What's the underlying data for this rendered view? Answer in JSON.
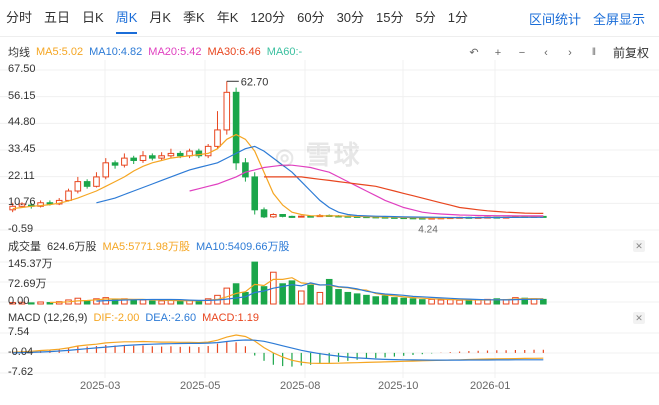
{
  "tabs": [
    "分时",
    "五日",
    "日K",
    "周K",
    "月K",
    "季K",
    "年K",
    "120分",
    "60分",
    "30分",
    "15分",
    "5分",
    "1分"
  ],
  "active_tab": "周K",
  "top_links": {
    "stats": "区间统计",
    "fullscreen": "全屏显示"
  },
  "price_legend": {
    "label": "均线",
    "items": [
      {
        "text": "MA5:5.02",
        "color": "#f5a623"
      },
      {
        "text": "MA10:4.82",
        "color": "#2d7bd6"
      },
      {
        "text": "MA20:5.42",
        "color": "#e040c0"
      },
      {
        "text": "MA30:6.46",
        "color": "#e8461f"
      },
      {
        "text": "MA60:-",
        "color": "#3cc0a0"
      }
    ]
  },
  "controls": {
    "adjust": "前复权"
  },
  "price_axis": [
    "67.50",
    "56.15",
    "44.80",
    "33.45",
    "22.11",
    "10.76",
    "-0.59"
  ],
  "annotations": {
    "high": "62.70",
    "low": "4.24"
  },
  "watermark": "雪球",
  "volume_legend": {
    "label": "成交量",
    "value": "624.6万股",
    "items": [
      {
        "text": "MA5:5771.98万股",
        "color": "#f5a623"
      },
      {
        "text": "MA10:5409.66万股",
        "color": "#2d7bd6"
      }
    ]
  },
  "volume_axis": [
    "145.37万",
    "72.69万",
    "0.00"
  ],
  "macd_legend": {
    "label": "MACD (12,26,9)",
    "items": [
      {
        "text": "DIF:-2.00",
        "color": "#f5a623"
      },
      {
        "text": "DEA:-2.60",
        "color": "#2d7bd6"
      },
      {
        "text": "MACD:1.19",
        "color": "#e8461f"
      }
    ]
  },
  "macd_axis": [
    "7.54",
    "-0.04",
    "-7.62"
  ],
  "x_axis": [
    "2025-03",
    "2025-05",
    "2025-08",
    "2025-10",
    "2026-01"
  ],
  "chart_data": {
    "type": "candlestick",
    "price_ylim": [
      -0.59,
      67.5
    ],
    "volume_ylim": [
      0,
      145.37
    ],
    "macd_ylim": [
      -7.62,
      7.54
    ],
    "candles": [
      [
        8,
        9.5,
        7,
        11
      ],
      [
        9.5,
        10.5,
        9,
        11.2
      ],
      [
        10,
        9.5,
        8.5,
        11
      ],
      [
        9.5,
        11,
        9,
        12
      ],
      [
        11,
        10.5,
        9.8,
        12
      ],
      [
        10.5,
        12,
        10,
        13
      ],
      [
        12,
        16,
        11.5,
        17
      ],
      [
        16,
        20,
        15,
        22
      ],
      [
        20,
        18,
        17,
        21
      ],
      [
        18,
        22,
        17.5,
        24
      ],
      [
        22,
        28,
        21,
        30
      ],
      [
        28,
        27,
        25.5,
        29
      ],
      [
        27,
        30,
        26,
        32
      ],
      [
        30,
        29,
        27.5,
        31
      ],
      [
        29,
        31,
        28,
        33
      ],
      [
        31,
        30,
        29,
        32
      ],
      [
        30,
        31,
        29,
        32.5
      ],
      [
        31,
        32,
        30,
        34
      ],
      [
        32,
        31,
        30,
        33
      ],
      [
        31,
        33,
        30,
        34
      ],
      [
        33,
        31,
        30,
        34
      ],
      [
        31,
        35,
        30,
        36
      ],
      [
        35,
        42,
        34,
        50
      ],
      [
        42,
        58,
        40,
        62.7
      ],
      [
        58,
        28,
        25,
        60
      ],
      [
        28,
        22,
        20,
        30
      ],
      [
        22,
        8,
        6,
        24
      ],
      [
        8,
        5,
        4.5,
        9
      ],
      [
        5,
        6,
        4.6,
        6.5
      ],
      [
        6,
        5.2,
        4.8,
        6.2
      ],
      [
        5.2,
        5,
        4.6,
        5.5
      ],
      [
        5,
        5.3,
        4.8,
        5.6
      ],
      [
        5.3,
        5.1,
        4.9,
        5.5
      ],
      [
        5.1,
        5.6,
        5,
        6.2
      ],
      [
        5.6,
        5.4,
        5.1,
        6
      ],
      [
        5.4,
        5.3,
        5,
        5.8
      ],
      [
        5.3,
        5.2,
        5,
        5.6
      ],
      [
        5.2,
        5.1,
        4.9,
        5.4
      ],
      [
        5.1,
        5,
        4.8,
        5.3
      ],
      [
        5,
        4.9,
        4.7,
        5.2
      ],
      [
        4.9,
        4.8,
        4.6,
        5.1
      ],
      [
        4.8,
        4.7,
        4.5,
        5
      ],
      [
        4.7,
        4.6,
        4.4,
        4.9
      ],
      [
        4.6,
        4.5,
        4.3,
        4.8
      ],
      [
        4.5,
        4.4,
        4.24,
        4.7
      ],
      [
        4.4,
        4.5,
        4.3,
        4.7
      ],
      [
        4.5,
        4.6,
        4.4,
        4.8
      ],
      [
        4.6,
        4.7,
        4.5,
        4.9
      ],
      [
        4.7,
        4.8,
        4.6,
        5
      ],
      [
        4.8,
        4.7,
        4.6,
        5
      ],
      [
        4.7,
        4.8,
        4.6,
        5
      ],
      [
        4.8,
        4.9,
        4.7,
        5.1
      ],
      [
        4.9,
        4.8,
        4.7,
        5.1
      ],
      [
        4.8,
        4.9,
        4.7,
        5.1
      ],
      [
        4.9,
        5.2,
        4.8,
        5.6
      ],
      [
        5.2,
        5,
        4.8,
        5.4
      ],
      [
        5,
        5.2,
        4.9,
        5.6
      ],
      [
        5.2,
        5.1,
        4.9,
        5.4
      ]
    ],
    "volume": [
      5,
      6,
      4,
      7,
      5,
      8,
      14,
      20,
      12,
      18,
      22,
      15,
      18,
      12,
      14,
      10,
      11,
      13,
      10,
      12,
      10,
      18,
      30,
      55,
      70,
      40,
      145,
      60,
      110,
      70,
      80,
      45,
      65,
      40,
      85,
      50,
      40,
      35,
      30,
      25,
      28,
      22,
      20,
      18,
      15,
      16,
      14,
      15,
      13,
      12,
      14,
      16,
      18,
      15,
      22,
      20,
      18,
      16
    ],
    "macd": [
      0.5,
      0.8,
      0.9,
      1.1,
      1.2,
      1.5,
      2,
      2.5,
      2.4,
      2.6,
      3,
      2.8,
      3,
      2.7,
      2.8,
      2.5,
      2.4,
      2.5,
      2.3,
      2.4,
      2.2,
      2.6,
      3.5,
      4.5,
      4,
      2.5,
      -1,
      -3,
      -4.5,
      -5,
      -5.2,
      -4.8,
      -4.5,
      -4,
      -3.8,
      -3.4,
      -3,
      -2.6,
      -2.3,
      -2,
      -1.7,
      -1.4,
      -1.1,
      -0.8,
      -0.5,
      -0.2,
      0.1,
      0.3,
      0.5,
      0.7,
      0.8,
      0.9,
      1,
      1,
      1.1,
      1.1,
      1.2,
      1.19
    ],
    "price_ma": {
      "MA5": [
        8.5,
        9,
        9.5,
        9.8,
        10.2,
        10.8,
        11.8,
        13,
        14.5,
        16,
        18,
        20,
        22,
        24.5,
        26.5,
        28,
        29,
        30,
        30.5,
        31,
        31.5,
        32,
        34,
        38,
        40,
        38,
        33,
        24,
        15,
        10,
        7,
        6,
        5.5,
        5.4,
        5.4,
        5.4,
        5.3,
        5.2,
        5.1,
        5,
        4.95,
        4.85,
        4.75,
        4.65,
        4.55,
        4.5,
        4.5,
        4.55,
        4.6,
        4.65,
        4.7,
        4.75,
        4.8,
        4.85,
        4.9,
        4.95,
        5,
        5.02
      ],
      "MA10": [
        null,
        null,
        null,
        null,
        null,
        null,
        null,
        null,
        null,
        11,
        12,
        13,
        14.5,
        16,
        17.5,
        19,
        20.5,
        22,
        23.5,
        25,
        26,
        27,
        28,
        30,
        32,
        34,
        35,
        33,
        30,
        27,
        24,
        20,
        16,
        12,
        9,
        7,
        6,
        5.6,
        5.4,
        5.3,
        5.2,
        5.1,
        5,
        4.95,
        4.9,
        4.85,
        4.8,
        4.75,
        4.7,
        4.7,
        4.7,
        4.72,
        4.74,
        4.76,
        4.78,
        4.8,
        4.81,
        4.82
      ],
      "MA20": [
        null,
        null,
        null,
        null,
        null,
        null,
        null,
        null,
        null,
        null,
        null,
        null,
        null,
        null,
        null,
        null,
        null,
        null,
        null,
        16,
        17,
        18,
        19,
        20.5,
        22,
        24,
        25,
        26,
        26.5,
        27,
        27,
        26.5,
        26,
        25,
        24,
        22,
        20,
        18,
        16,
        14,
        12,
        10.5,
        9,
        8,
        7,
        6.5,
        6.2,
        6,
        5.8,
        5.7,
        5.6,
        5.55,
        5.5,
        5.48,
        5.46,
        5.44,
        5.43,
        5.42
      ],
      "MA30": [
        null,
        null,
        null,
        null,
        null,
        null,
        null,
        null,
        null,
        null,
        null,
        null,
        null,
        null,
        null,
        null,
        null,
        null,
        null,
        null,
        null,
        null,
        null,
        null,
        null,
        null,
        null,
        22,
        22,
        22,
        22,
        22,
        21.5,
        21,
        20.5,
        20,
        19.5,
        19,
        18.5,
        18,
        17,
        16,
        15,
        14,
        13,
        12,
        11,
        10,
        9,
        8.5,
        8,
        7.6,
        7.3,
        7,
        6.8,
        6.6,
        6.5,
        6.46
      ]
    },
    "volume_ma": {
      "MA5": [
        null,
        null,
        null,
        null,
        5.4,
        6,
        7.6,
        10.8,
        12.2,
        14.4,
        17.2,
        17.4,
        17,
        15.8,
        16.2,
        13.8,
        13,
        12,
        11.6,
        11.2,
        11.2,
        12.6,
        16,
        25,
        36.6,
        42.6,
        68,
        64,
        85,
        85,
        91,
        73,
        70,
        66,
        65,
        58,
        56,
        50,
        48,
        36,
        31,
        28,
        25,
        22,
        20,
        18,
        16.6,
        15.6,
        14.6,
        14,
        14,
        14,
        14.6,
        15.2,
        17,
        18.2,
        18.2,
        18.2
      ],
      "MA10": [
        null,
        null,
        null,
        null,
        null,
        null,
        null,
        null,
        null,
        9.9,
        11.6,
        12.5,
        13.9,
        14.4,
        15.3,
        15.5,
        15.6,
        15.5,
        15.3,
        13.6,
        12.5,
        12.5,
        13.7,
        17.1,
        20.7,
        24.8,
        39.9,
        44.9,
        54.7,
        60.5,
        66.7,
        62.7,
        72.9,
        65.9,
        66.9,
        59.8,
        57.3,
        52.3,
        44.3,
        38.8,
        34.6,
        32.5,
        30,
        26.4,
        24.8,
        22.9,
        21.1,
        19.9,
        18.1,
        16.8,
        15.5,
        14.6,
        14.6,
        14.3,
        15.3,
        15.9,
        16.3,
        16.5
      ]
    },
    "macd_lines": {
      "DIF": [
        0.2,
        0.4,
        0.6,
        0.9,
        1.1,
        1.4,
        1.9,
        2.6,
        3,
        3.3,
        3.8,
        4,
        4.2,
        4.2,
        4.3,
        4.2,
        4.1,
        4.1,
        4,
        4,
        3.9,
        4.1,
        4.8,
        6,
        6.8,
        6.2,
        4.5,
        2,
        0,
        -1.6,
        -2.8,
        -3.5,
        -3.9,
        -4,
        -4,
        -3.9,
        -3.8,
        -3.7,
        -3.6,
        -3.5,
        -3.4,
        -3.3,
        -3.2,
        -3.1,
        -3,
        -2.9,
        -2.8,
        -2.7,
        -2.6,
        -2.5,
        -2.4,
        -2.3,
        -2.25,
        -2.2,
        -2.15,
        -2.1,
        -2.05,
        -2
      ],
      "DEA": [
        0,
        0.1,
        0.2,
        0.35,
        0.5,
        0.7,
        0.95,
        1.3,
        1.6,
        1.9,
        2.2,
        2.5,
        2.8,
        3,
        3.2,
        3.3,
        3.4,
        3.5,
        3.55,
        3.6,
        3.6,
        3.7,
        3.9,
        4.3,
        4.7,
        4.9,
        4.8,
        4.4,
        3.6,
        2.7,
        1.8,
        1,
        0.3,
        -0.3,
        -0.8,
        -1.2,
        -1.6,
        -1.9,
        -2.1,
        -2.3,
        -2.45,
        -2.55,
        -2.62,
        -2.67,
        -2.7,
        -2.72,
        -2.73,
        -2.73,
        -2.72,
        -2.71,
        -2.7,
        -2.68,
        -2.66,
        -2.65,
        -2.63,
        -2.62,
        -2.61,
        -2.6
      ]
    }
  },
  "colors": {
    "up": "#e8461f",
    "down": "#1aa64a",
    "grid": "#f0f0f0"
  }
}
